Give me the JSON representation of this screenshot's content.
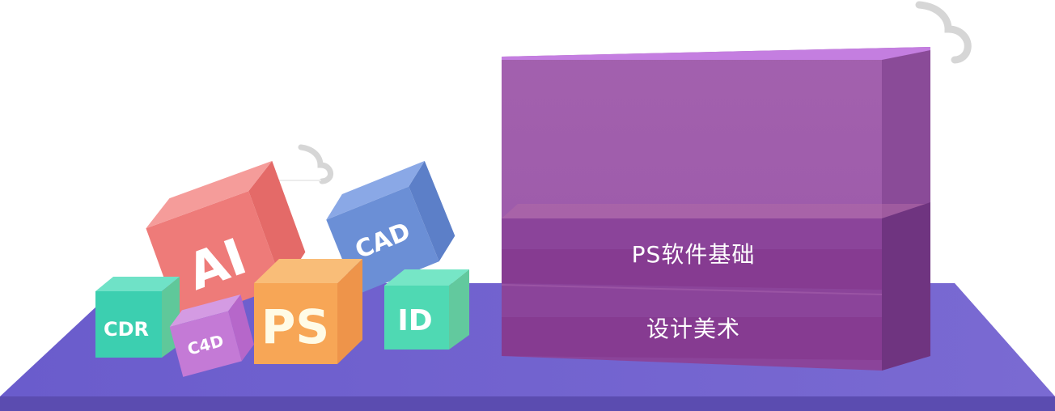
{
  "cubes": [
    {
      "label": "AI",
      "color_front": "#ee7b79",
      "color_side": "#e46a68",
      "color_top": "#f49998"
    },
    {
      "label": "CAD",
      "color_front": "#6b8fd6",
      "color_side": "#5c7fc8",
      "color_top": "#8aa8e6"
    },
    {
      "label": "CDR",
      "color_front": "#3ccfb0",
      "color_side": "#5fc89a",
      "color_top": "#6fe2c7"
    },
    {
      "label": "C4D",
      "color_front": "#c47ad6",
      "color_side": "#b667ca",
      "color_top": "#d49be3"
    },
    {
      "label": "PS",
      "color_front": "#f7a656",
      "color_side": "#ee944a",
      "color_top": "#f9bd78"
    },
    {
      "label": "ID",
      "color_front": "#4fd9b3",
      "color_side": "#62c99e",
      "color_top": "#76e6c6"
    }
  ],
  "bars": [
    {
      "label": "PS软件基础"
    },
    {
      "label": "设计美术"
    }
  ],
  "colors": {
    "platform_top": "#7163cc",
    "platform_edge": "#5a4bb3",
    "box_front": "#9e5eac",
    "box_side": "#8a4f9a",
    "box_top": "#c47ee0",
    "band": "#853d8d",
    "cloud": "#d8d8d8"
  }
}
